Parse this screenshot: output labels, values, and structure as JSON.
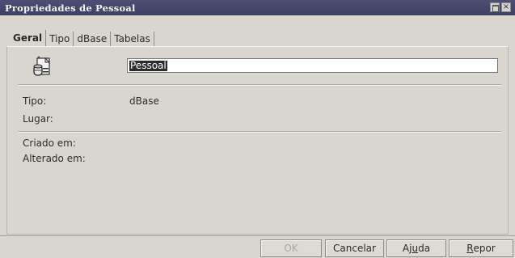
{
  "window": {
    "title": "Propriedades de Pessoal",
    "maximize_icon": "maximize-icon",
    "close_glyph": "×"
  },
  "tabs": [
    {
      "label": "Geral",
      "active": true
    },
    {
      "label": "Tipo",
      "active": false
    },
    {
      "label": "dBase",
      "active": false
    },
    {
      "label": "Tabelas",
      "active": false
    }
  ],
  "general": {
    "icon": "database-file-icon",
    "name_value": "Pessoal",
    "type_label": "Tipo:",
    "type_value": "dBase",
    "location_label": "Lugar:",
    "created_label": "Criado em:",
    "modified_label": "Alterado em:"
  },
  "buttons": {
    "ok": {
      "label": "OK",
      "enabled": false
    },
    "cancel": {
      "label": "Cancelar"
    },
    "help": {
      "label_pre": "Aj",
      "label_mnemonic": "u",
      "label_post": "da"
    },
    "reset": {
      "label_mnemonic": "R",
      "label_post": "epor"
    }
  },
  "colors": {
    "titlebar": "#3d3f63",
    "background": "#d9d6cf",
    "selection": "#2c2c2c"
  }
}
